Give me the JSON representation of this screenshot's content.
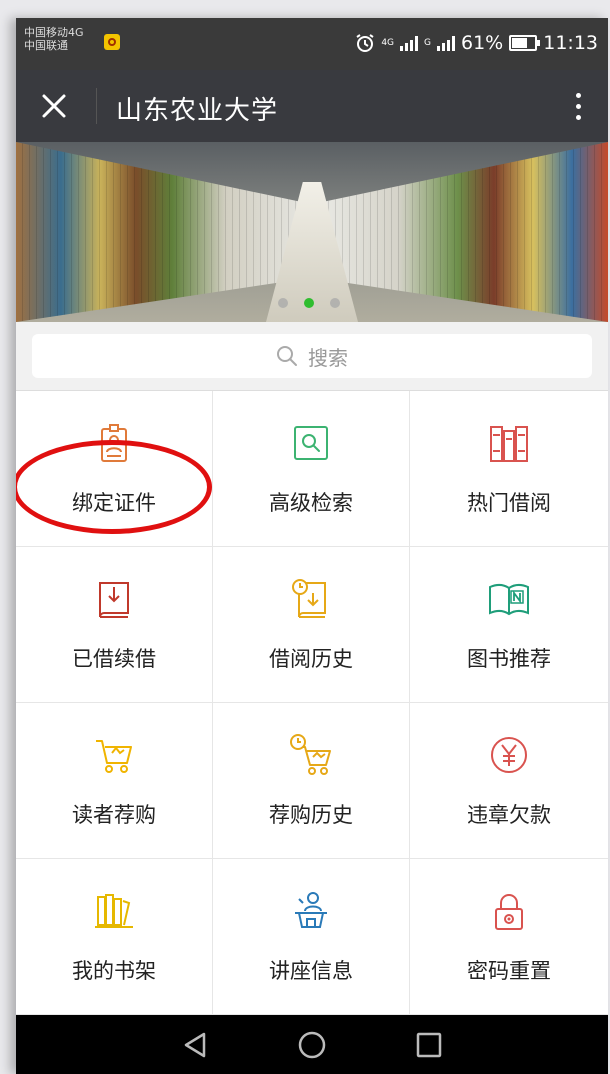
{
  "status": {
    "carrier1": "中国移动4G",
    "carrier2": "中国联通",
    "net1": "4G",
    "net2": "G",
    "battery": "61%",
    "time": "11:13"
  },
  "nav": {
    "title": "山东农业大学"
  },
  "banner": {
    "slides": 3,
    "active_slide": 2
  },
  "search": {
    "placeholder": "搜索"
  },
  "menu": [
    {
      "label": "绑定证件",
      "icon": "id-card-icon",
      "color": "#e07a3a"
    },
    {
      "label": "高级检索",
      "icon": "advanced-search-icon",
      "color": "#3cb371"
    },
    {
      "label": "热门借阅",
      "icon": "books-icon",
      "color": "#d9534f"
    },
    {
      "label": "已借续借",
      "icon": "renew-book-icon",
      "color": "#c0392b"
    },
    {
      "label": "借阅历史",
      "icon": "history-book-icon",
      "color": "#e6a817"
    },
    {
      "label": "图书推荐",
      "icon": "open-book-icon",
      "color": "#1f9e7a"
    },
    {
      "label": "读者荐购",
      "icon": "cart-icon",
      "color": "#f0b400"
    },
    {
      "label": "荐购历史",
      "icon": "cart-history-icon",
      "color": "#e6a817"
    },
    {
      "label": "违章欠款",
      "icon": "yen-icon",
      "color": "#d9534f"
    },
    {
      "label": "我的书架",
      "icon": "bookshelf-icon",
      "color": "#e6b800"
    },
    {
      "label": "讲座信息",
      "icon": "lecture-icon",
      "color": "#2a7ab8"
    },
    {
      "label": "密码重置",
      "icon": "lock-icon",
      "color": "#d9534f"
    }
  ]
}
